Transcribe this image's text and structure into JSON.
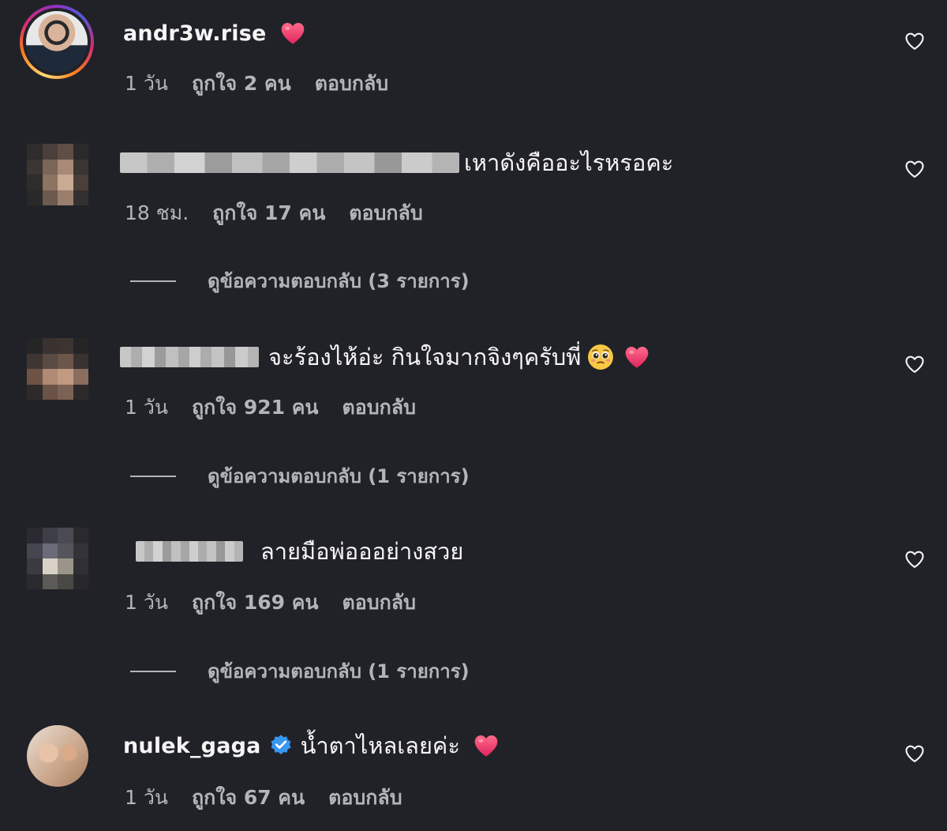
{
  "comments": [
    {
      "username": "andr3w.rise",
      "text": "",
      "time": "1 วัน",
      "likes": "ถูกใจ 2 คน",
      "reply": "ตอบกลับ"
    },
    {
      "username": "",
      "text": "เหาดังคืออะไรหรอคะ",
      "time": "18 ชม.",
      "likes": "ถูกใจ 17 คน",
      "reply": "ตอบกลับ",
      "view_replies": "ดูข้อความตอบกลับ (3 รายการ)"
    },
    {
      "username": "",
      "text": "จะร้องไห้อ่ะ กินใจมากจิงๆครับพี่",
      "time": "1 วัน",
      "likes": "ถูกใจ 921 คน",
      "reply": "ตอบกลับ",
      "view_replies": "ดูข้อความตอบกลับ (1 รายการ)"
    },
    {
      "username": "",
      "text": "ลายมือพ่อออย่างสวย",
      "time": "1 วัน",
      "likes": "ถูกใจ 169 คน",
      "reply": "ตอบกลับ",
      "view_replies": "ดูข้อความตอบกลับ (1 รายการ)"
    },
    {
      "username": "nulek_gaga",
      "text": "น้ำตาไหลเลยค่ะ",
      "time": "1 วัน",
      "likes": "ถูกใจ 67 คน",
      "reply": "ตอบกลับ"
    }
  ],
  "icons": {
    "like": "heart-outline-icon",
    "heart_emoji": "red-heart-emoji",
    "face_emoji": "pleading-face-emoji",
    "verified": "verified-badge-icon"
  },
  "colors": {
    "background": "#212228",
    "text": "#f5f5f5",
    "meta": "#b3b5ba",
    "verified": "#3897f0",
    "heart": "#ed4956"
  }
}
